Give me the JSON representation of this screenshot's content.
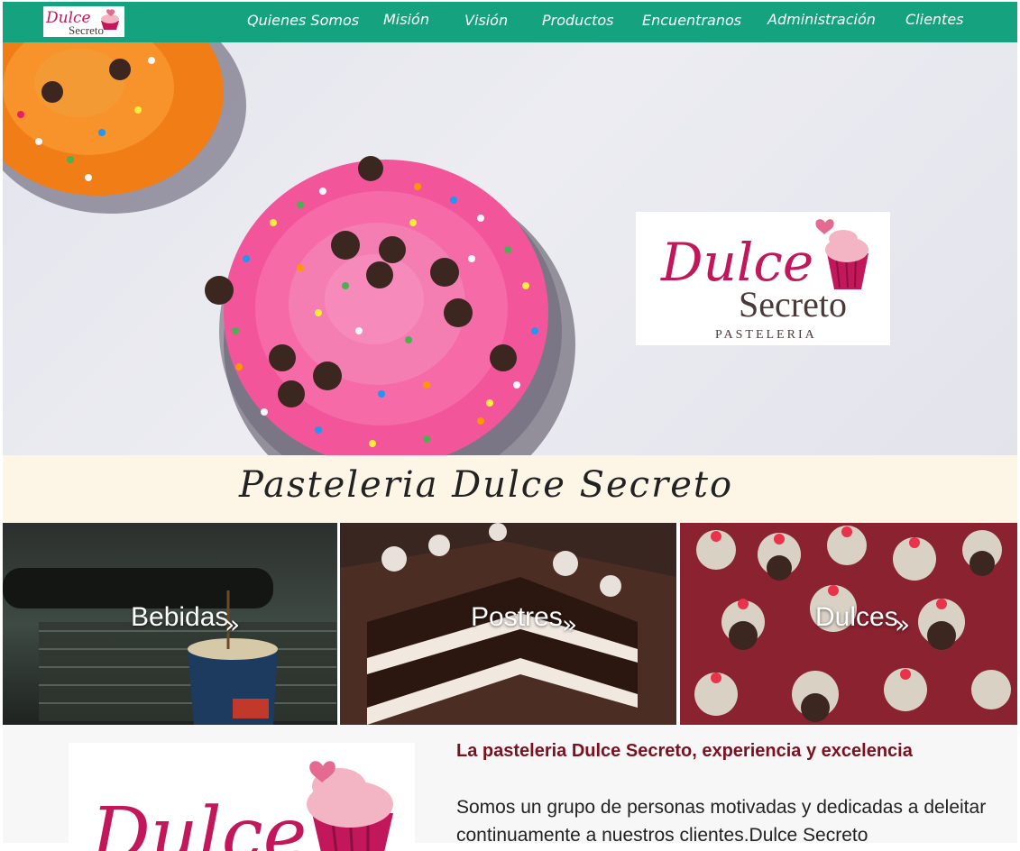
{
  "brand": {
    "name_line1": "Dulce",
    "name_line2": "Secreto",
    "tagline": "PASTELERIA"
  },
  "nav": {
    "items": [
      {
        "label": "Quienes Somos"
      },
      {
        "label": "Misión"
      },
      {
        "label": "Visión"
      },
      {
        "label": "Productos"
      },
      {
        "label": "Encuentranos"
      },
      {
        "label": "Administración"
      },
      {
        "label": "Clientes"
      }
    ]
  },
  "banner": {
    "title": "Pasteleria Dulce Secreto"
  },
  "categories": [
    {
      "label": "Bebidas",
      "arrow": "»"
    },
    {
      "label": "Postres",
      "arrow": "»"
    },
    {
      "label": "Dulces",
      "arrow": "»"
    }
  ],
  "about": {
    "heading": "La pasteleria Dulce Secreto, experiencia y excelencia",
    "body": "Somos un grupo de personas motivadas y dedicadas a deleitar continuamente a nuestros clientes.Dulce Secreto"
  },
  "colors": {
    "navbar": "#15a37f",
    "brand_pink": "#c2185b",
    "brand_dark": "#4a3a3a",
    "heading": "#7b1020",
    "band": "#fdf6e7"
  },
  "icons": {
    "cupcake": "cupcake-icon",
    "heart": "heart-icon",
    "chevron": "double-chevron-right-icon"
  }
}
